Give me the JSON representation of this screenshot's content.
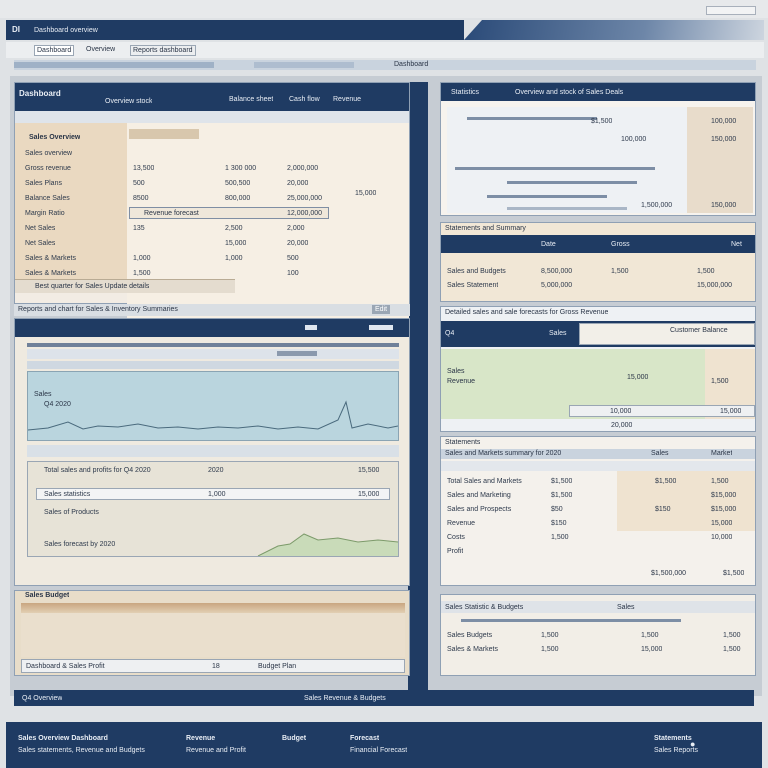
{
  "window": {
    "title": "Dashboard overview",
    "app_code": "DI",
    "menu": [
      "Dashboard",
      "Overview",
      "Reports dashboard"
    ],
    "tab_strip_right": "Dashboard"
  },
  "left_top_panel": {
    "header_title": "Dashboard",
    "header_cols": [
      "Overview stock",
      "Balance sheet",
      "Cash flow",
      "Revenue"
    ],
    "section_title": "Sales Overview",
    "rows": [
      {
        "label": "Sales overview",
        "a": "",
        "b": "",
        "c": ""
      },
      {
        "label": "Gross revenue",
        "a": "13,500",
        "b": "1 300 000",
        "c": "2,000,000"
      },
      {
        "label": "Sales Plans",
        "a": "500",
        "b": "500,500",
        "c": "20,000"
      },
      {
        "label": "Balance Sales",
        "a": "8500",
        "b": "800,000",
        "c": "25,000,000"
      },
      {
        "label": "Margin Ratio",
        "a": "",
        "b": "",
        "c": "12,000,000"
      },
      {
        "label": "Net Sales",
        "a": "135",
        "b": "2,500",
        "c": "2,000"
      },
      {
        "label": "Net Sales",
        "a": "",
        "b": "15,000",
        "c": "20,000"
      },
      {
        "label": "Sales & Markets",
        "a": "1,000",
        "b": "1,000",
        "c": "500"
      },
      {
        "label": "Sales & Markets",
        "a": "1,500",
        "b": "",
        "c": "100"
      }
    ],
    "highlight_label": "Revenue forecast",
    "side_value": "15,000",
    "footer": "Best quarter for Sales   Update details"
  },
  "left_mid_caption": "Reports and chart for Sales & Inventory Summaries",
  "left_mid_caption_btn": "Edit",
  "chart_panel": {
    "label_line1": "Sales",
    "label_line2": "Q4 2020",
    "list_rows": [
      {
        "label": "Total sales and profits for Q4 2020",
        "v1": "2020",
        "v2": "15,500"
      },
      {
        "label": "Sales statistics",
        "v1": "1,000",
        "v2": "15,000"
      },
      {
        "label": "Sales of Products",
        "v1": "",
        "v2": ""
      },
      {
        "label": "Sales forecast by 2020",
        "v1": "",
        "v2": ""
      }
    ]
  },
  "left_bottom_panel": {
    "title": "Sales Budget",
    "footer_label": "Dashboard & Sales Profit",
    "footer_value": "18",
    "footer_right": "Budget Plan"
  },
  "left_footer_bar": {
    "left": "Q4 Overview",
    "right": "Sales Revenue & Budgets"
  },
  "right_top_panel": {
    "title": "Statistics",
    "header_right": "Overview and stock of Sales Deals",
    "values": [
      "$1,500",
      "100,000",
      "100,000",
      "150,000",
      "1,500,000",
      "150,000"
    ]
  },
  "right_mid_panel": {
    "caption": "Statements and Summary",
    "header_cols": [
      "Date",
      "Gross",
      "Net"
    ],
    "rows": [
      {
        "label": "Sales and Budgets",
        "a": "8,500,000",
        "b": "1,500",
        "c": "1,500"
      },
      {
        "label": "Sales Statement",
        "a": "5,000,000",
        "b": "",
        "c": "15,000,000"
      }
    ]
  },
  "right_chart_panel": {
    "caption": "Detailed sales and sale forecasts for Gross Revenue",
    "left_tag": "Q4",
    "header_mid": "Sales",
    "header_right": "Customer Balance",
    "label1": "Sales",
    "label2": "Revenue",
    "value": "15,000",
    "side_values": [
      "1,500",
      "10,000",
      "15,000",
      "20,000"
    ]
  },
  "right_table_panel": {
    "caption": "Statements",
    "header": "Sales and Markets summary for 2020",
    "header_right": [
      "Sales",
      "Market"
    ],
    "rows": [
      {
        "label": "Total Sales and Markets",
        "a": "$1,500",
        "b": "$1,500",
        "c": "1,500"
      },
      {
        "label": "Sales and Marketing",
        "a": "$1,500",
        "b": "",
        "c": "$15,000"
      },
      {
        "label": "Sales and Prospects",
        "a": "$50",
        "b": "$150",
        "c": "$15,000"
      },
      {
        "label": "Revenue",
        "a": "$150",
        "b": "",
        "c": "15,000"
      },
      {
        "label": "Costs",
        "a": "1,500",
        "b": "",
        "c": "10,000"
      },
      {
        "label": "Profit",
        "a": "",
        "b": "",
        "c": ""
      }
    ],
    "total_label": "$1,500,000",
    "total_value": "$1,500"
  },
  "right_bottom_panel": {
    "title": "Sales Statistic & Budgets",
    "header_mid": "Sales",
    "rows": [
      {
        "label": "Sales Budgets",
        "a": "1,500",
        "b": "1,500",
        "c": "1,500"
      },
      {
        "label": "Sales & Markets",
        "a": "1,500",
        "b": "15,000",
        "c": "1,500"
      }
    ]
  },
  "footer": {
    "col1_title": "Sales Overview Dashboard",
    "col1_sub": "Sales statements, Revenue and Budgets",
    "col2_title": "Revenue",
    "col2_sub": "Revenue and Profit",
    "col3_title": "Budget",
    "col4_title": "Forecast",
    "col4_sub": "Financial Forecast",
    "col5_title": "Statements",
    "col5_sub": "Sales Reports"
  },
  "colors": {
    "navy": "#1f3b63",
    "beige": "#efe3d0",
    "chart_blue": "#b9d6df",
    "chart_green": "#d7e6c8"
  }
}
